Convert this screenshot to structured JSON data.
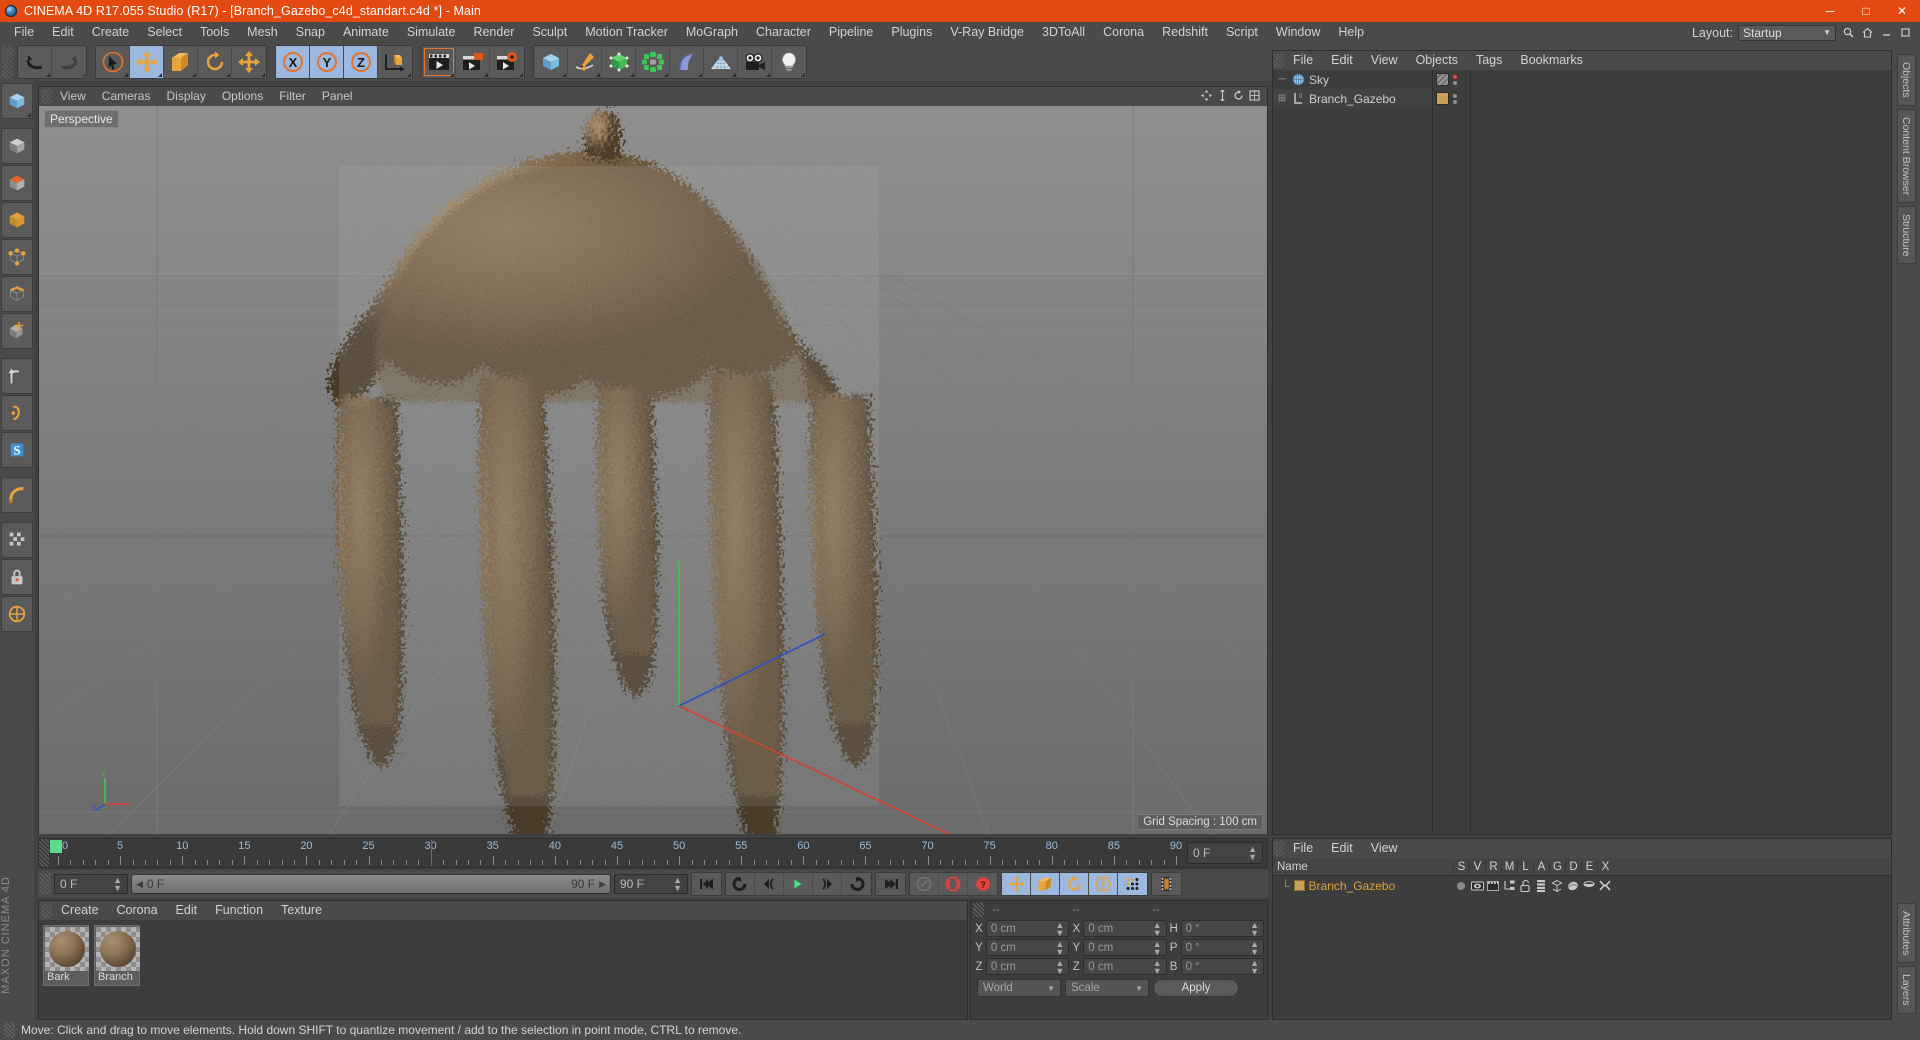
{
  "window": {
    "title": "CINEMA 4D R17.055 Studio (R17) - [Branch_Gazebo_c4d_standart.c4d *] - Main",
    "minimize": "─",
    "maximize": "□",
    "close": "✕"
  },
  "menubar": {
    "items": [
      "File",
      "Edit",
      "Create",
      "Select",
      "Tools",
      "Mesh",
      "Snap",
      "Animate",
      "Simulate",
      "Render",
      "Sculpt",
      "Motion Tracker",
      "MoGraph",
      "Character",
      "Pipeline",
      "Plugins",
      "V-Ray Bridge",
      "3DToAll",
      "Corona",
      "Redshift",
      "Script",
      "Window",
      "Help"
    ],
    "layout_label": "Layout:",
    "layout_value": "Startup",
    "layout_chevron": "▼",
    "search_icon": "search-icon",
    "home_icon": "home-icon",
    "minimize_icon": "minimize-icon",
    "restore_icon": "restore-icon"
  },
  "toolbar": {
    "groups": [
      {
        "name": "history",
        "buttons": [
          {
            "name": "undo-button",
            "icon": "undo-icon",
            "selected": false
          },
          {
            "name": "redo-button",
            "icon": "redo-icon",
            "selected": false
          }
        ]
      },
      {
        "name": "transform",
        "buttons": [
          {
            "name": "live-selection-button",
            "icon": "cursor-select-icon",
            "selected": false
          },
          {
            "name": "move-button",
            "icon": "move-arrows-icon",
            "selected": true
          },
          {
            "name": "scale-button",
            "icon": "scale-icon",
            "selected": false
          },
          {
            "name": "rotate-button",
            "icon": "rotate-icon",
            "selected": false
          },
          {
            "name": "move-duplicate-button",
            "icon": "move-arrows-icon",
            "selected": false
          }
        ]
      },
      {
        "name": "axis-lock",
        "buttons": [
          {
            "name": "lock-x-button",
            "icon": "axis-x-icon",
            "selected": true
          },
          {
            "name": "lock-y-button",
            "icon": "axis-y-icon",
            "selected": true
          },
          {
            "name": "lock-z-button",
            "icon": "axis-z-icon",
            "selected": true
          },
          {
            "name": "world-coordinate-button",
            "icon": "world-axis-icon",
            "selected": false
          }
        ]
      },
      {
        "name": "render",
        "buttons": [
          {
            "name": "render-view-button",
            "icon": "render-view-icon",
            "selected": false
          },
          {
            "name": "render-to-picture-viewer-button",
            "icon": "render-picture-icon",
            "selected": false
          },
          {
            "name": "render-settings-button",
            "icon": "render-settings-icon",
            "selected": false
          }
        ]
      },
      {
        "name": "objects",
        "buttons": [
          {
            "name": "add-cube-button",
            "icon": "cube-icon",
            "selected": false
          },
          {
            "name": "add-spline-button",
            "icon": "pen-spline-icon",
            "selected": false
          },
          {
            "name": "add-generator-button",
            "icon": "hypernurbs-icon",
            "selected": false
          },
          {
            "name": "add-array-button",
            "icon": "array-icon",
            "selected": false
          },
          {
            "name": "add-deformer-button",
            "icon": "bend-deformer-icon",
            "selected": false
          },
          {
            "name": "add-environment-button",
            "icon": "floor-environment-icon",
            "selected": false
          },
          {
            "name": "add-camera-button",
            "icon": "camera-icon",
            "selected": false
          },
          {
            "name": "add-light-button",
            "icon": "light-bulb-icon",
            "selected": false
          }
        ]
      }
    ]
  },
  "left_toolbar": {
    "buttons": [
      {
        "name": "make-editable-button",
        "icon": "make-editable-icon"
      },
      {
        "name": "model-mode-button",
        "icon": "model-mode-icon"
      },
      {
        "name": "texture-mode-button",
        "icon": "texture-mode-icon"
      },
      {
        "name": "polygon-mode-button",
        "icon": "polygon-mode-icon"
      },
      {
        "name": "point-mode-button",
        "icon": "point-mode-icon"
      },
      {
        "name": "edge-mode-button",
        "icon": "edge-mode-icon"
      },
      {
        "name": "object-axis-mode-button",
        "icon": "object-axis-icon"
      },
      {
        "name": "enable-axis-button",
        "icon": "enable-axis-icon"
      },
      {
        "name": "viewport-solo-button",
        "icon": "viewport-solo-icon"
      },
      {
        "name": "workplane-button",
        "icon": "workplane-icon"
      },
      {
        "name": "snap-button",
        "icon": "snap-magnet-icon"
      },
      {
        "name": "quantize-button",
        "icon": "quantize-icon"
      },
      {
        "name": "lock-workplane-button",
        "icon": "lock-workplane-icon"
      },
      {
        "name": "workplane-axis-button",
        "icon": "workplane-axis-icon"
      }
    ],
    "brand": "MAXON CINEMA 4D"
  },
  "viewport": {
    "menu": [
      "View",
      "Cameras",
      "Display",
      "Options",
      "Filter",
      "Panel"
    ],
    "camera_label": "Perspective",
    "grid_spacing": "Grid Spacing : 100 cm",
    "nav_icons": [
      "move-view-icon",
      "scale-view-icon",
      "rotate-view-icon",
      "maximize-view-icon"
    ],
    "axis_gizmo": {
      "x": "X",
      "y": "Y",
      "z": "Z"
    }
  },
  "timeline": {
    "marks": [
      0,
      5,
      10,
      15,
      20,
      25,
      30,
      35,
      40,
      45,
      50,
      55,
      60,
      65,
      70,
      75,
      80,
      85,
      90
    ],
    "end_frame_field": "0 F"
  },
  "animbar": {
    "current_frame": "0 F",
    "slider_start": "0 F",
    "slider_end": "90 F",
    "max_frame": "90 F",
    "buttons": [
      {
        "name": "go-to-start-button",
        "icon": "skip-start-icon",
        "selected": false
      },
      {
        "name": "play-reverse-button",
        "icon": "play-reverse-icon",
        "selected": false
      },
      {
        "name": "previous-key-button",
        "icon": "previous-key-icon",
        "selected": false
      },
      {
        "name": "play-forward-button",
        "icon": "play-icon",
        "selected": false
      },
      {
        "name": "next-key-button",
        "icon": "next-key-icon",
        "selected": false
      },
      {
        "name": "loop-button",
        "icon": "loop-icon",
        "selected": false
      },
      {
        "name": "go-to-end-button",
        "icon": "skip-end-icon",
        "selected": false
      },
      {
        "name": "record-active-objects-button",
        "icon": "key-record-icon",
        "selected": false
      },
      {
        "name": "autokeying-button",
        "icon": "autokey-icon",
        "selected": false
      },
      {
        "name": "keyframe-selection-button",
        "icon": "keyframe-question-icon",
        "selected": false
      },
      {
        "name": "record-position-button",
        "icon": "position-arrows-icon",
        "selected": true
      },
      {
        "name": "record-scale-button",
        "icon": "scale-key-icon",
        "selected": true
      },
      {
        "name": "record-rotation-button",
        "icon": "rotation-key-icon",
        "selected": true
      },
      {
        "name": "record-parameter-button",
        "icon": "parameter-key-icon",
        "selected": true
      },
      {
        "name": "record-pla-button",
        "icon": "point-level-anim-icon",
        "selected": true
      },
      {
        "name": "timeline-view-button",
        "icon": "filmstrip-icon",
        "selected": false
      }
    ]
  },
  "material_manager": {
    "menu": [
      "Create",
      "Corona",
      "Edit",
      "Function",
      "Texture"
    ],
    "materials": [
      {
        "name": "Bark"
      },
      {
        "name": "Branch"
      }
    ]
  },
  "coordinates": {
    "headers": [
      "--",
      "--",
      "--"
    ],
    "rows": [
      {
        "pos_label": "X",
        "pos_value": "0 cm",
        "size_label": "X",
        "size_value": "0 cm",
        "rot_label": "H",
        "rot_value": "0 °"
      },
      {
        "pos_label": "Y",
        "pos_value": "0 cm",
        "size_label": "Y",
        "size_value": "0 cm",
        "rot_label": "P",
        "rot_value": "0 °"
      },
      {
        "pos_label": "Z",
        "pos_value": "0 cm",
        "size_label": "Z",
        "size_value": "0 cm",
        "rot_label": "B",
        "rot_value": "0 °"
      }
    ],
    "system": "World",
    "mode": "Scale",
    "apply": "Apply"
  },
  "object_manager": {
    "menu": [
      "File",
      "Edit",
      "View",
      "Objects",
      "Tags",
      "Bookmarks"
    ],
    "items": [
      {
        "name": "Sky",
        "icon": "sky-object-icon",
        "expandable": false,
        "tag_color": "#8c8c8c",
        "dot_color": "#e04b3a"
      },
      {
        "name": "Branch_Gazebo",
        "icon": "null-object-icon",
        "expandable": true,
        "tag_color": "#c8a05a",
        "dot_color": "#8e8e8e"
      }
    ]
  },
  "structure_manager": {
    "menu": [
      "File",
      "Edit",
      "View"
    ],
    "name_header": "Name",
    "columns": [
      "S",
      "V",
      "R",
      "M",
      "L",
      "A",
      "G",
      "D",
      "E",
      "X"
    ],
    "rows": [
      {
        "name": "Branch_Gazebo",
        "icons": [
          "dot-gray-icon",
          "eye-icon",
          "render-clapper-icon",
          "hierarchy-icon",
          "unlock-icon",
          "layer-list-icon",
          "axis-gizmo-icon",
          "deformer-icon",
          "cap-icon",
          "xpresso-icon"
        ]
      }
    ]
  },
  "right_tabs": [
    "Objects",
    "Content Browser",
    "Structure",
    "Attributes",
    "Layers"
  ],
  "statusbar": {
    "message": "Move: Click and drag to move elements. Hold down SHIFT to quantize movement / add to the selection in point mode, CTRL to remove."
  },
  "colors": {
    "accent_orange": "#e24a12",
    "panel_bg": "#3d3d3d",
    "toolbar_bg": "#4a4a4a",
    "selected_blue": "#9cb8de",
    "axis_x_red": "#d8402e",
    "axis_y_green": "#4fc14f",
    "axis_z_blue": "#3a5fd0",
    "tree_orange": "#e0a23c"
  }
}
